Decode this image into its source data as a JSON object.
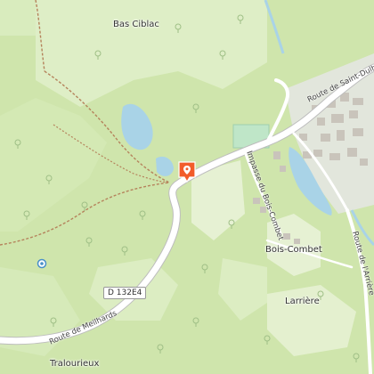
{
  "map": {
    "places": {
      "bas_ciblac": "Bas Ciblac",
      "bois_combet": "Bois-Combet",
      "larriere": "Larrière",
      "tralourieux": "Tralourieux"
    },
    "roads": {
      "route_saint_dulh": "Route de Saint-Dulh",
      "impasse_bois_combet": "Impasse du Bois-Combet",
      "route_arriere": "Route de l'Arrière",
      "route_meilhards": "Route de Meilhards",
      "shield_d132e4": "D 132E4"
    },
    "colors": {
      "forest": "#cfe5ac",
      "meadow": "#e4f0cf",
      "water": "#a9d3e7",
      "road": "#ffffff",
      "path": "#b5835c",
      "marker": "#f25c2a"
    },
    "marker_icon": "location-pin-icon",
    "spring_icon": "spring-circle-icon"
  }
}
